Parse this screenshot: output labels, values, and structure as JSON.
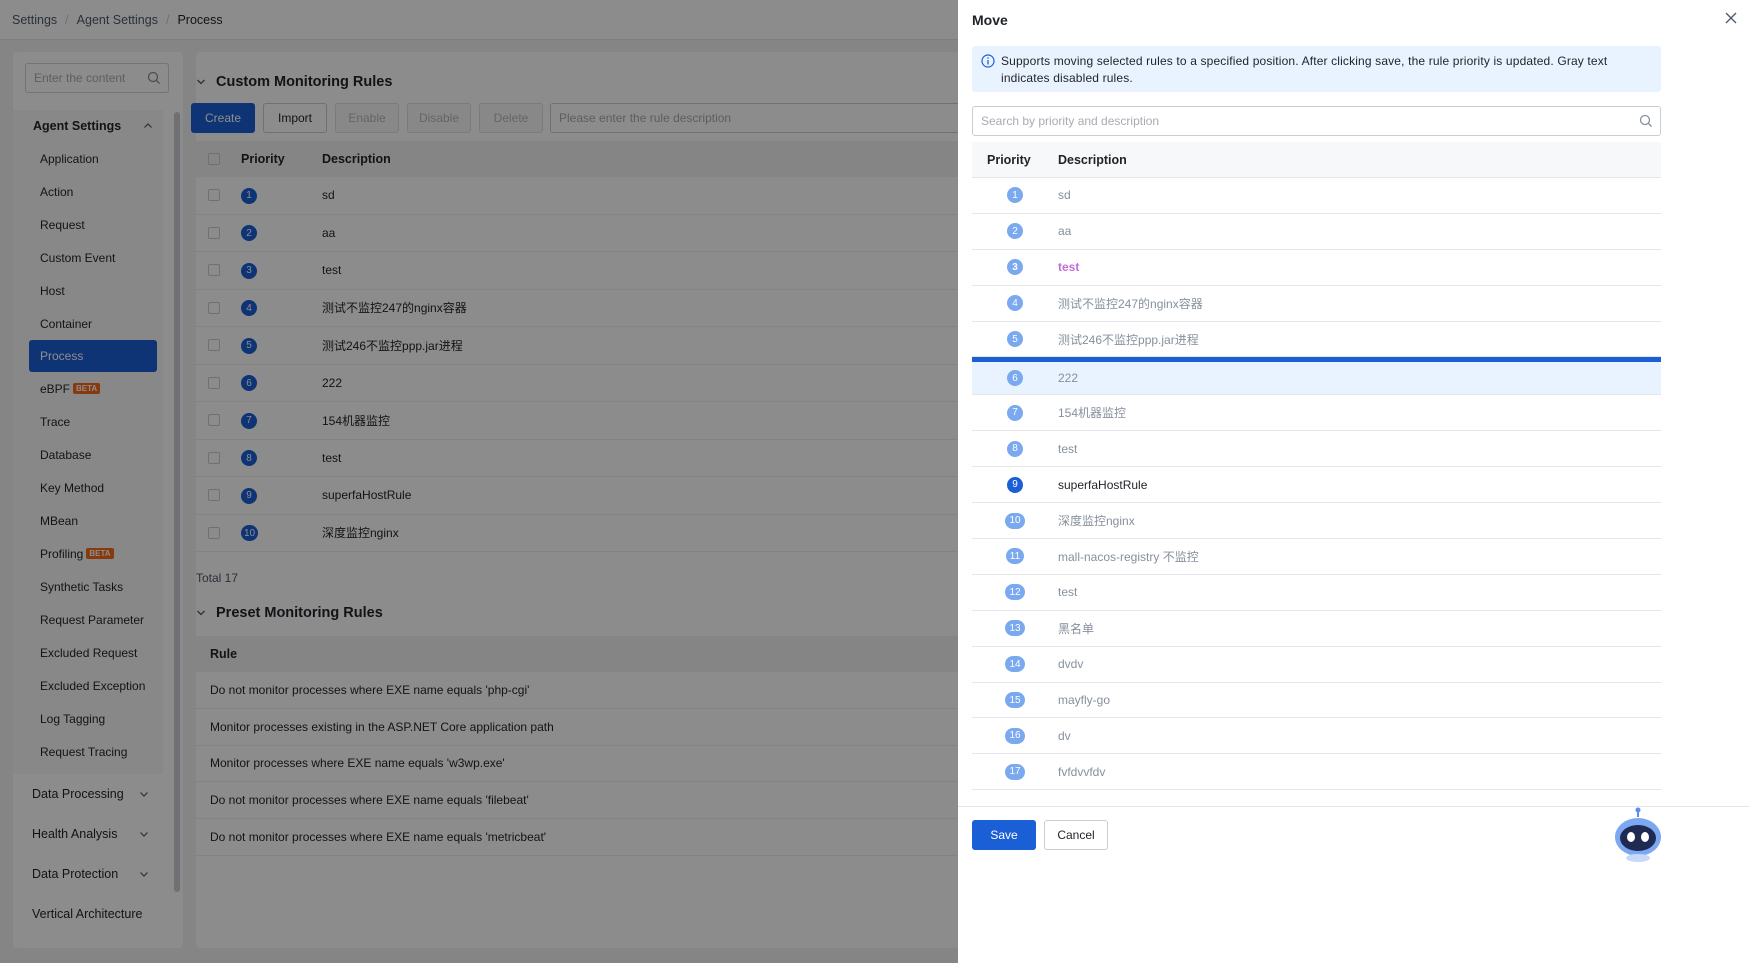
{
  "breadcrumb": [
    "Settings",
    "Agent Settings",
    "Process"
  ],
  "sidebar": {
    "search_placeholder": "Enter the content",
    "group_title": "Agent Settings",
    "items": [
      {
        "label": "Application"
      },
      {
        "label": "Action"
      },
      {
        "label": "Request"
      },
      {
        "label": "Custom Event"
      },
      {
        "label": "Host"
      },
      {
        "label": "Container"
      },
      {
        "label": "Process",
        "active": true
      },
      {
        "label": "eBPF",
        "badge": "BETA"
      },
      {
        "label": "Trace"
      },
      {
        "label": "Database"
      },
      {
        "label": "Key Method"
      },
      {
        "label": "MBean"
      },
      {
        "label": "Profiling",
        "badge": "BETA"
      },
      {
        "label": "Synthetic Tasks"
      },
      {
        "label": "Request Parameter"
      },
      {
        "label": "Excluded Request"
      },
      {
        "label": "Excluded Exception"
      },
      {
        "label": "Log Tagging"
      },
      {
        "label": "Request Tracing"
      }
    ],
    "sections": [
      "Data Processing",
      "Health Analysis",
      "Data Protection",
      "Vertical Architecture"
    ]
  },
  "custom_rules": {
    "title": "Custom Monitoring Rules",
    "buttons": {
      "create": "Create",
      "import": "Import",
      "enable": "Enable",
      "disable": "Disable",
      "delete": "Delete"
    },
    "search_placeholder": "Please enter the rule description",
    "columns": {
      "priority": "Priority",
      "description": "Description"
    },
    "rows": [
      {
        "priority": "1",
        "description": "sd"
      },
      {
        "priority": "2",
        "description": "aa"
      },
      {
        "priority": "3",
        "description": "test"
      },
      {
        "priority": "4",
        "description": "测试不监控247的nginx容器"
      },
      {
        "priority": "5",
        "description": "测试246不监控ppp.jar进程"
      },
      {
        "priority": "6",
        "description": "222"
      },
      {
        "priority": "7",
        "description": "154机器监控"
      },
      {
        "priority": "8",
        "description": "test"
      },
      {
        "priority": "9",
        "description": "superfaHostRule"
      },
      {
        "priority": "10",
        "description": "深度监控nginx"
      }
    ],
    "total": "Total 17"
  },
  "preset_rules": {
    "title": "Preset Monitoring Rules",
    "column": "Rule",
    "rows": [
      "Do not monitor processes where EXE name equals 'php-cgi'",
      "Monitor processes existing in the ASP.NET Core application path",
      "Monitor processes where EXE name equals 'w3wp.exe'",
      "Do not monitor processes where EXE name equals 'filebeat'",
      "Do not monitor processes where EXE name equals 'metricbeat'"
    ]
  },
  "drawer": {
    "title": "Move",
    "info": "Supports moving selected rules to a specified position. After clicking save, the rule priority is updated. Gray text indicates disabled rules.",
    "search_placeholder": "Search by priority and description",
    "columns": {
      "priority": "Priority",
      "description": "Description"
    },
    "rows": [
      {
        "priority": "1",
        "description": "sd",
        "state": "disabled"
      },
      {
        "priority": "2",
        "description": "aa",
        "state": "disabled"
      },
      {
        "priority": "3",
        "description": "test",
        "state": "highlight"
      },
      {
        "priority": "4",
        "description": "测试不监控247的nginx容器",
        "state": "disabled"
      },
      {
        "priority": "5",
        "description": "测试246不监控ppp.jar进程",
        "state": "disabled"
      },
      {
        "priority": "6",
        "description": "222",
        "state": "disabled",
        "selected": true
      },
      {
        "priority": "7",
        "description": "154机器监控",
        "state": "disabled"
      },
      {
        "priority": "8",
        "description": "test",
        "state": "disabled"
      },
      {
        "priority": "9",
        "description": "superfaHostRule",
        "state": "enabled"
      },
      {
        "priority": "10",
        "description": "深度监控nginx",
        "state": "disabled"
      },
      {
        "priority": "11",
        "description": "mall-nacos-registry 不监控",
        "state": "disabled"
      },
      {
        "priority": "12",
        "description": "test",
        "state": "disabled"
      },
      {
        "priority": "13",
        "description": "黑名单",
        "state": "disabled"
      },
      {
        "priority": "14",
        "description": "dvdv",
        "state": "disabled"
      },
      {
        "priority": "15",
        "description": "mayfly-go",
        "state": "disabled"
      },
      {
        "priority": "16",
        "description": "dv",
        "state": "disabled"
      },
      {
        "priority": "17",
        "description": "fvfdvvfdv",
        "state": "disabled"
      }
    ],
    "save_label": "Save",
    "cancel_label": "Cancel"
  },
  "colors": {
    "primary": "#1a5fd6",
    "disabled_badge": "#7aa9ef",
    "highlight_text": "#c26cd8",
    "info_bg": "#e8f3ff"
  },
  "icons": [
    "search-icon",
    "chevron-up-icon",
    "chevron-down-icon",
    "close-icon",
    "info-icon",
    "assistant-robot-icon"
  ]
}
